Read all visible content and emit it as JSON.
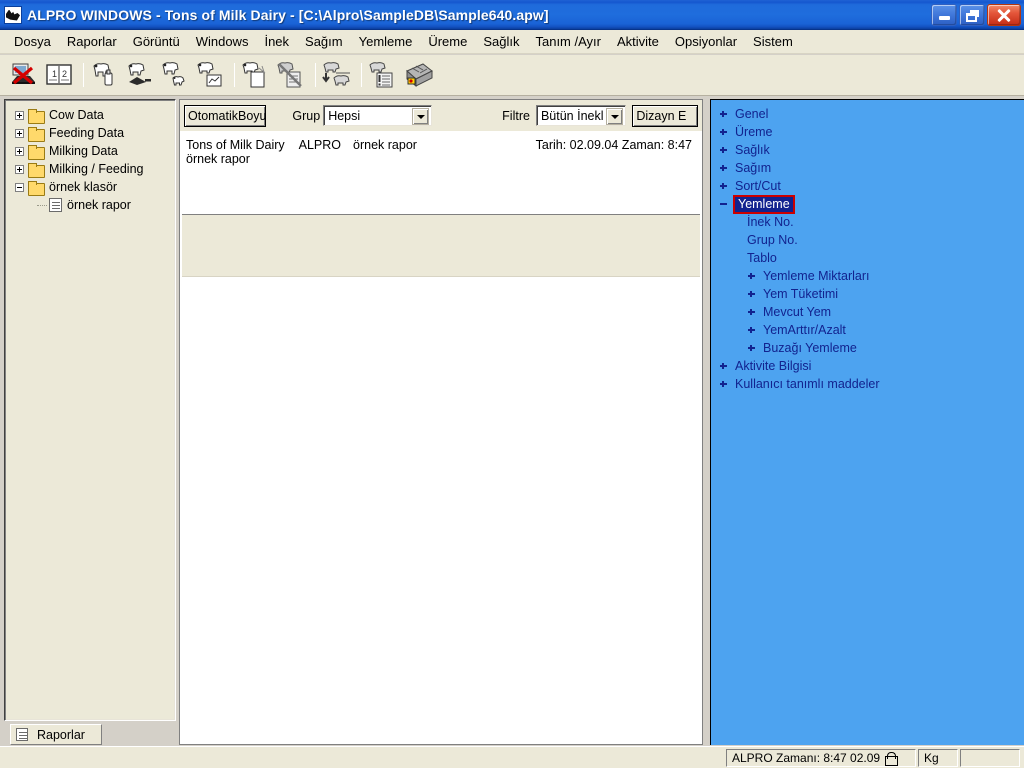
{
  "window": {
    "title": "ALPRO WINDOWS -  Tons of Milk Dairy - [C:\\Alpro\\SampleDB\\Sample640.apw]",
    "app_icon": "cow-logo-icon",
    "minimize_label": "",
    "restore_label": "",
    "close_label": ""
  },
  "menubar": {
    "items": [
      {
        "label": "Dosya"
      },
      {
        "label": "Raporlar"
      },
      {
        "label": "Görüntü"
      },
      {
        "label": "Windows"
      },
      {
        "label": "İnek"
      },
      {
        "label": "Sağım"
      },
      {
        "label": "Yemleme"
      },
      {
        "label": "Üreme"
      },
      {
        "label": "Sağlık"
      },
      {
        "label": "Tanım /Ayır"
      },
      {
        "label": "Aktivite"
      },
      {
        "label": "Opsiyonlar"
      },
      {
        "label": "Sistem"
      }
    ]
  },
  "toolbar": {
    "buttons": [
      {
        "icon": "computer-disabled-icon"
      },
      {
        "icon": "book-pages-icon"
      },
      {
        "icon": "cow-bottle-icon"
      },
      {
        "icon": "cow-feed-icon"
      },
      {
        "icon": "cow-calf-icon"
      },
      {
        "icon": "cow-chart-icon"
      },
      {
        "icon": "cow-document-icon"
      },
      {
        "icon": "cow-document-disabled-icon"
      },
      {
        "icon": "cow-sort-icon"
      },
      {
        "icon": "cow-report-alert-icon"
      },
      {
        "icon": "calculator-icon"
      }
    ]
  },
  "left_tree": {
    "items": [
      {
        "label": "Cow Data",
        "expander": "plus",
        "icon": "folder-icon",
        "depth": 0
      },
      {
        "label": "Feeding Data",
        "expander": "plus",
        "icon": "folder-icon",
        "depth": 0
      },
      {
        "label": "Milking Data",
        "expander": "plus",
        "icon": "folder-icon",
        "depth": 0
      },
      {
        "label": "Milking / Feeding",
        "expander": "plus",
        "icon": "folder-icon",
        "depth": 0
      },
      {
        "label": "örnek klasör",
        "expander": "minus",
        "icon": "folder-icon",
        "depth": 0
      },
      {
        "label": "örnek rapor",
        "expander": "none",
        "icon": "document-icon",
        "depth": 1
      }
    ],
    "tab_label": "Raporlar",
    "tab_icon": "document-icon"
  },
  "center": {
    "autosize_button": "OtomatikBoyu",
    "grup_label": "Grup",
    "grup_value": "Hepsi",
    "filtre_label": "Filtre",
    "filtre_value": "Bütün İnekl",
    "design_button": "Dizayn E",
    "report": {
      "dairy": "Tons of Milk Dairy",
      "system": "ALPRO",
      "name": "örnek rapor",
      "date_time": "Tarih: 02.09.04 Zaman: 8:47",
      "subtitle": "örnek rapor"
    }
  },
  "right_tree": {
    "items": [
      {
        "label": "Genel",
        "expander": "plus",
        "depth": 0,
        "selected": false
      },
      {
        "label": "Üreme",
        "expander": "plus",
        "depth": 0,
        "selected": false
      },
      {
        "label": "Sağlık",
        "expander": "plus",
        "depth": 0,
        "selected": false
      },
      {
        "label": "Sağım",
        "expander": "plus",
        "depth": 0,
        "selected": false
      },
      {
        "label": "Sort/Cut",
        "expander": "plus",
        "depth": 0,
        "selected": false
      },
      {
        "label": "Yemleme",
        "expander": "minus",
        "depth": 0,
        "selected": true
      },
      {
        "label": "İnek No.",
        "expander": "none",
        "depth": 1,
        "selected": false
      },
      {
        "label": "Grup No.",
        "expander": "none",
        "depth": 1,
        "selected": false
      },
      {
        "label": "Tablo",
        "expander": "none",
        "depth": 1,
        "selected": false
      },
      {
        "label": "Yemleme Miktarları",
        "expander": "plus",
        "depth": 1,
        "selected": false
      },
      {
        "label": "Yem Tüketimi",
        "expander": "plus",
        "depth": 1,
        "selected": false
      },
      {
        "label": "Mevcut Yem",
        "expander": "plus",
        "depth": 1,
        "selected": false
      },
      {
        "label": "YemArttır/Azalt",
        "expander": "plus",
        "depth": 1,
        "selected": false
      },
      {
        "label": "Buzağı Yemleme",
        "expander": "plus",
        "depth": 1,
        "selected": false
      },
      {
        "label": "Aktivite Bilgisi",
        "expander": "plus",
        "depth": 0,
        "selected": false
      },
      {
        "label": "Kullanıcı tanımlı maddeler",
        "expander": "plus",
        "depth": 0,
        "selected": false
      }
    ]
  },
  "statusbar": {
    "alpro_time": "ALPRO Zamanı: 8:47   02.09",
    "lock_icon": "lock-icon",
    "unit": "Kg",
    "cell_extra": ""
  },
  "colors": {
    "title_blue": "#1f6ddd",
    "panel_beige": "#ece9d8",
    "tree_blue": "#4da3f0",
    "tree_text": "#12238f",
    "selection_navy": "#12238f",
    "highlight_red": "#cc0000"
  }
}
